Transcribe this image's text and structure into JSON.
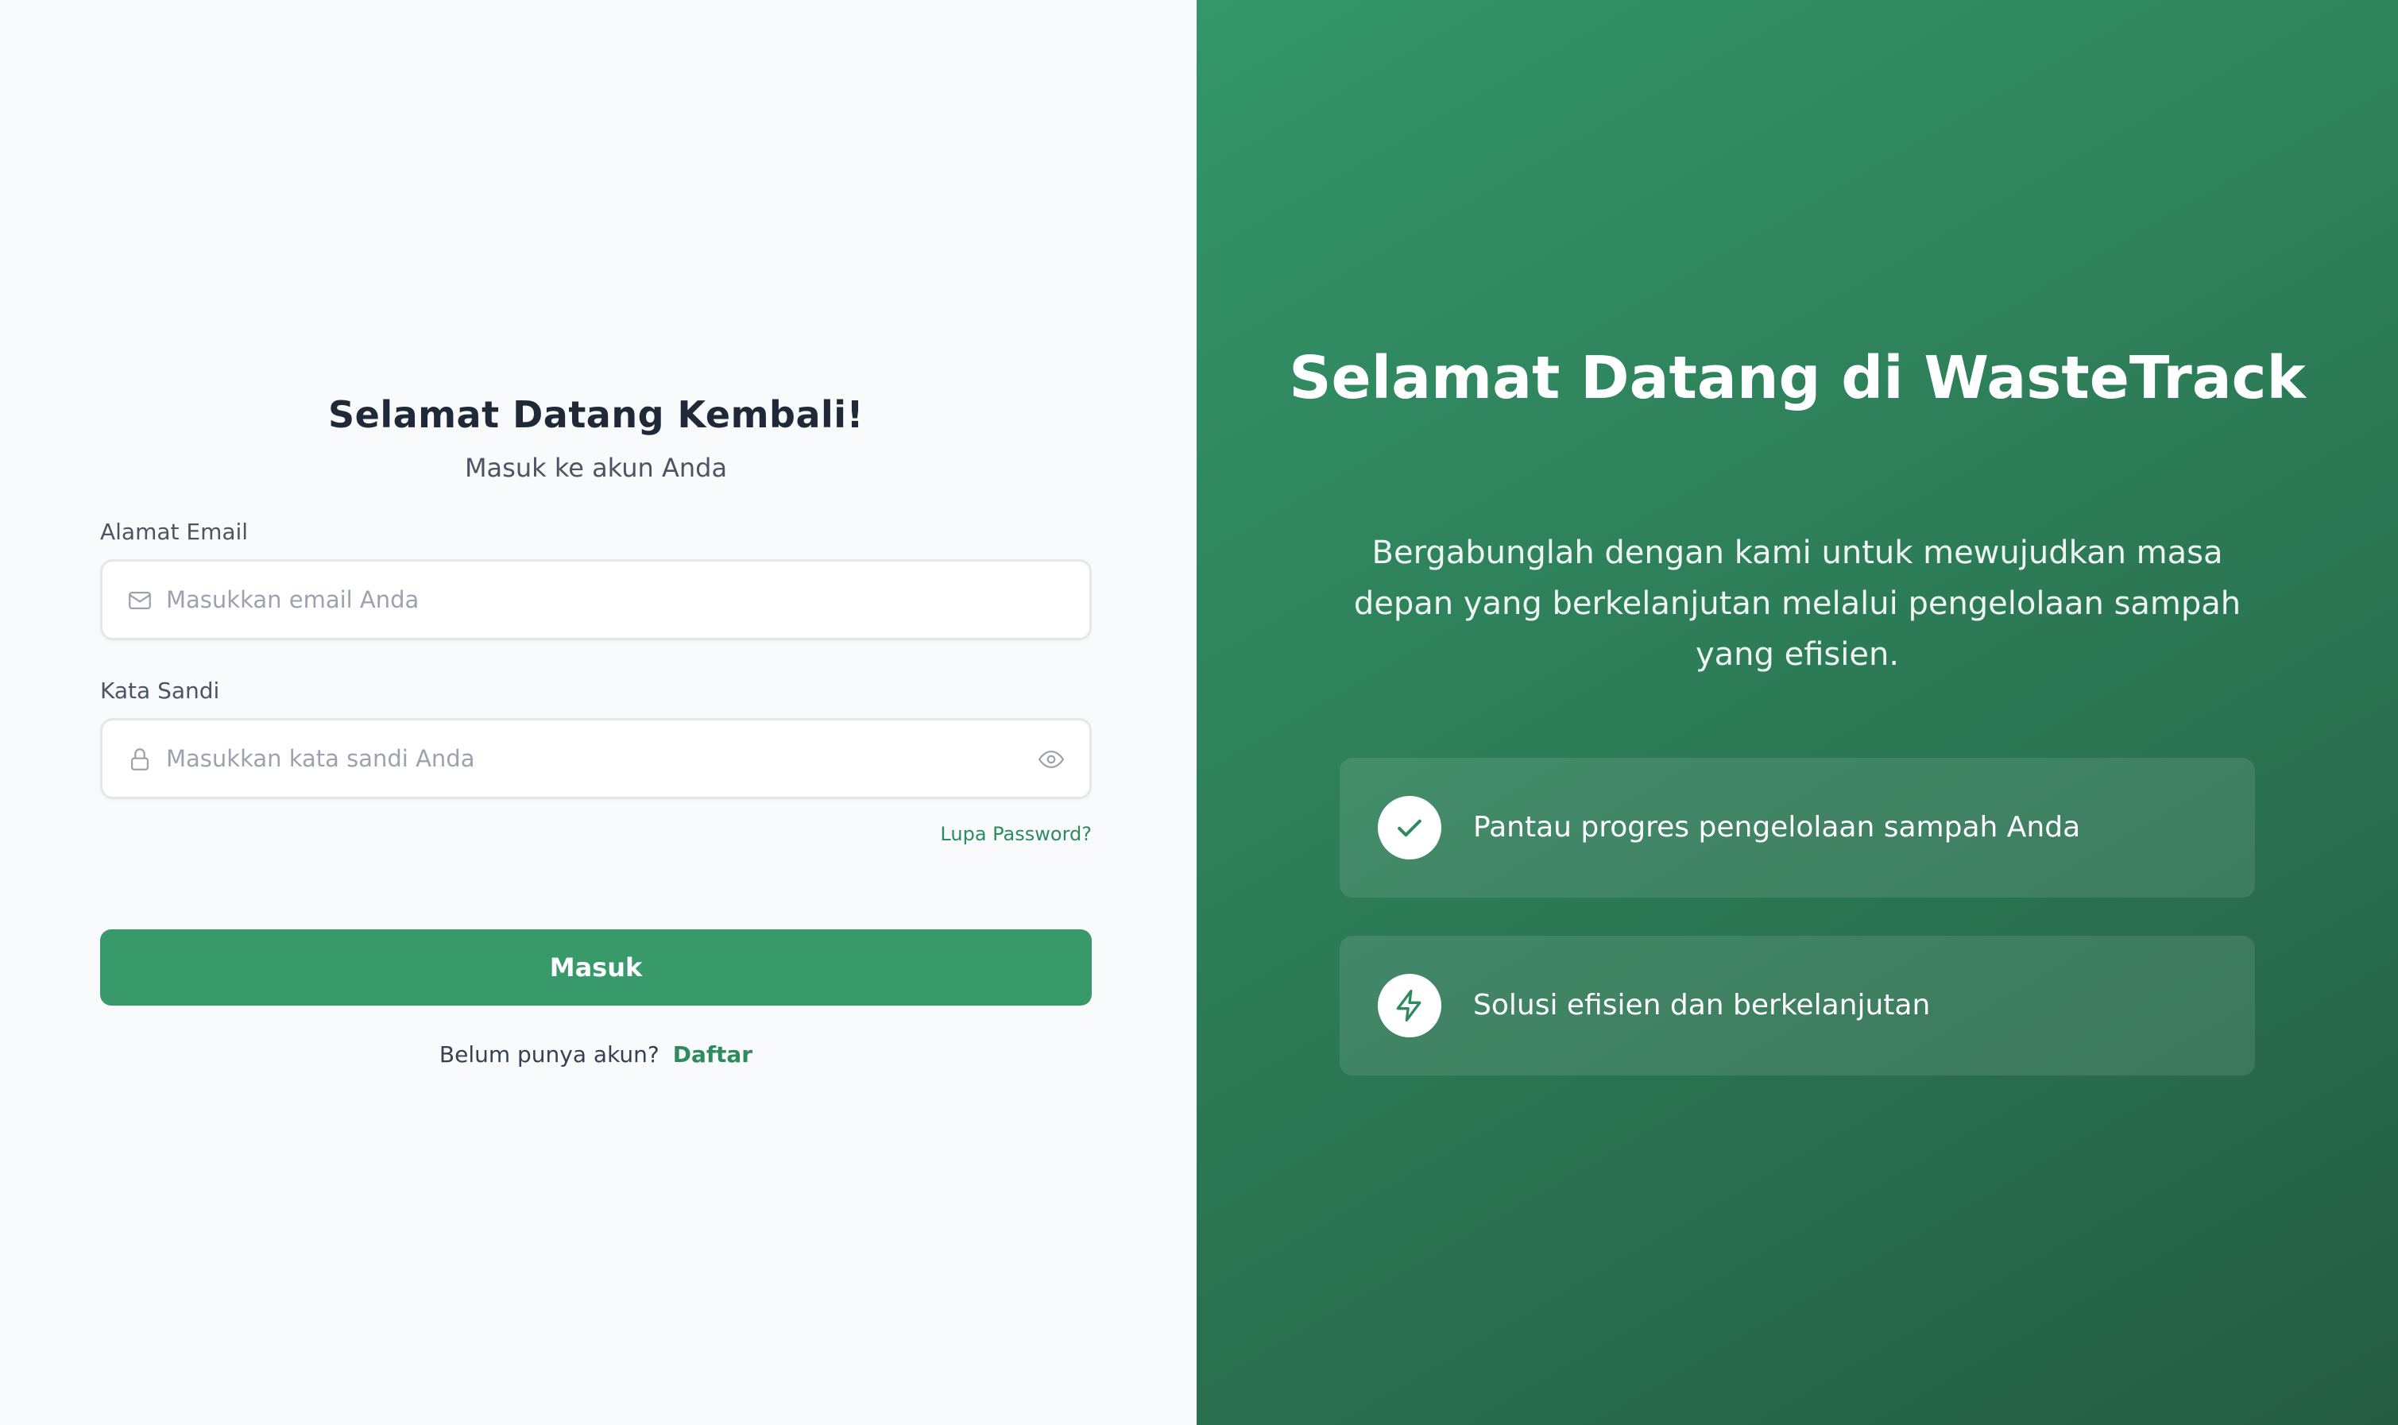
{
  "login": {
    "title": "Selamat Datang Kembali!",
    "subtitle": "Masuk ke akun Anda",
    "email_label": "Alamat Email",
    "email_placeholder": "Masukkan email Anda",
    "email_value": "",
    "password_label": "Kata Sandi",
    "password_placeholder": "Masukkan kata sandi Anda",
    "password_value": "",
    "forgot_password": "Lupa Password?",
    "submit_label": "Masuk",
    "register_prompt": "Belum punya akun?",
    "register_link": "Daftar"
  },
  "hero": {
    "title": "Selamat Datang di WasteTrack",
    "description": "Bergabunglah dengan kami untuk mewujudkan masa depan yang berkelanjutan melalui pengelolaan sampah yang efisien.",
    "features": [
      {
        "icon": "check-icon",
        "text": "Pantau progres pengelolaan sampah Anda"
      },
      {
        "icon": "lightning-icon",
        "text": "Solusi efisien dan berkelanjutan"
      }
    ]
  },
  "colors": {
    "primary_green": "#38996b",
    "link_green": "#2e8b5d",
    "panel_gradient_start": "#34966a",
    "panel_gradient_end": "#245c43",
    "left_background": "#f8fafc"
  }
}
